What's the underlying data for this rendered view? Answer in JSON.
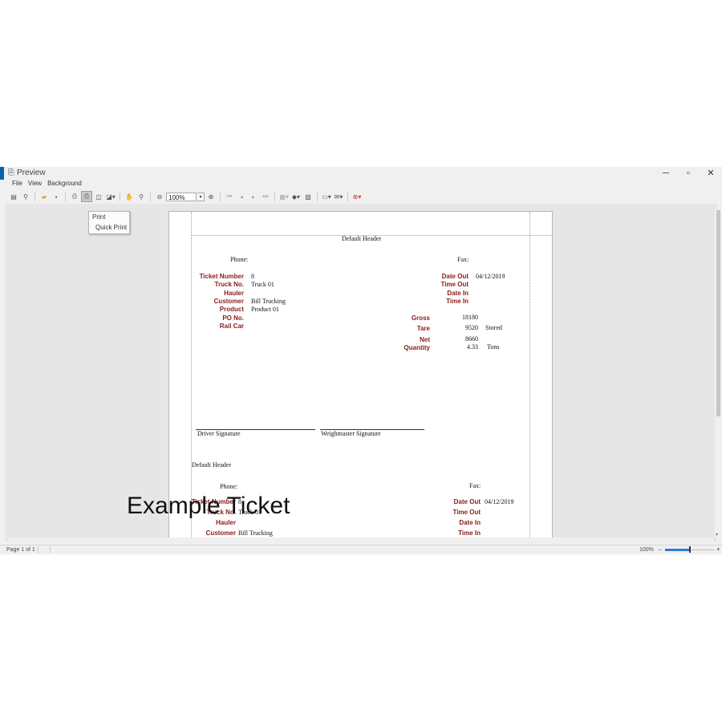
{
  "window": {
    "title": "Preview",
    "minimize": "─",
    "maximize": "▫",
    "close": "✕"
  },
  "menu": {
    "items": [
      "File",
      "View",
      "Background"
    ]
  },
  "toolbar": {
    "zoom_value": "100%",
    "zoom_dropdown_arrow": "▾"
  },
  "popup_menu": {
    "print": "Print",
    "quick_print": "Quick Print"
  },
  "report": {
    "header": "Default Header",
    "phone_label": "Phone:",
    "fax_label": "Fax:",
    "ticket_number_label": "Ticket Number",
    "ticket_number": "8",
    "truck_no_label": "Truck No.",
    "truck_no": "Truck 01",
    "hauler_label": "Hauler",
    "customer_label": "Customer",
    "customer": "Bill Trucking",
    "product_label": "Product",
    "product": "Product 01",
    "po_no_label": "PO No.",
    "rail_car_label": "Rail Car",
    "date_out_label": "Date Out",
    "date_out": "04/12/2019",
    "time_out_label": "Time Out",
    "date_in_label": "Date In",
    "time_in_label": "Time In",
    "gross_label": "Gross",
    "gross": "18180",
    "tare_label": "Tare",
    "tare": "9520",
    "tare_note": "Stored",
    "net_label": "Net",
    "net": "8660",
    "quantity_label": "Quantity",
    "quantity": "4.33",
    "quantity_unit": "Tons",
    "driver_signature": "Driver Signature",
    "weighmaster_signature": "Weighmaster Signature",
    "second_header": "Default Header",
    "second_ticket_number_label": "Ticket Number",
    "second_ticket_number": "8",
    "second_truck_no_label": "Truck No.",
    "second_truck_no": "Truck 01",
    "second_customer_label": "Customer",
    "second_customer": "Bill Trucking",
    "second_date_out": "04/12/2019"
  },
  "watermark": "Example Ticket",
  "status": {
    "page": "Page 1 of 1",
    "zoom": "100%",
    "zoom_minus": "−",
    "zoom_plus": "+"
  },
  "colors": {
    "label_red": "#8b1a1a",
    "accent": "#0063b1",
    "zoom_slider": "#2e7bd1"
  }
}
